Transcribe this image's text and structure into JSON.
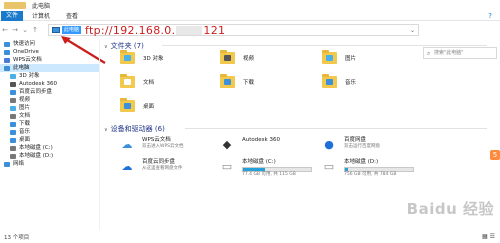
{
  "window": {
    "title": "此电脑"
  },
  "ribbon": {
    "file": "文件",
    "tabs": [
      "计算机",
      "查看"
    ],
    "help": "?"
  },
  "address": {
    "selected_label": "此电脑",
    "typed_prefix": "ftp://192.168.0.",
    "typed_suffix": "121"
  },
  "search": {
    "placeholder": "搜索\"此电脑\""
  },
  "nav": {
    "items": [
      {
        "label": "快速访问",
        "color": "#3c8fd9"
      },
      {
        "label": "OneDrive",
        "color": "#3c8fd9"
      },
      {
        "label": "WPS云文档",
        "color": "#4a7bd6"
      },
      {
        "label": "此电脑",
        "color": "#3c8fd9",
        "selected": true
      },
      {
        "label": "3D 对象",
        "color": "#4ab0e8",
        "indent": true
      },
      {
        "label": "Autodesk 360",
        "color": "#555555",
        "indent": true
      },
      {
        "label": "百度云同步盘",
        "color": "#3c8fd9",
        "indent": true
      },
      {
        "label": "视频",
        "color": "#777777",
        "indent": true
      },
      {
        "label": "图片",
        "color": "#4ab0e8",
        "indent": true
      },
      {
        "label": "文档",
        "color": "#777777",
        "indent": true
      },
      {
        "label": "下载",
        "color": "#3c8fd9",
        "indent": true
      },
      {
        "label": "音乐",
        "color": "#3c8fd9",
        "indent": true
      },
      {
        "label": "桌面",
        "color": "#3c8fd9",
        "indent": true
      },
      {
        "label": "本地磁盘 (C:)",
        "color": "#777777",
        "indent": true
      },
      {
        "label": "本地磁盘 (D:)",
        "color": "#777777",
        "indent": true
      },
      {
        "label": "网络",
        "color": "#3c8fd9"
      }
    ]
  },
  "folders": {
    "heading": "文件夹 (7)",
    "items": [
      {
        "label": "3D 对象",
        "color": "#4ab0e8"
      },
      {
        "label": "视频",
        "color": "#555555"
      },
      {
        "label": "图片",
        "color": "#4ab0e8"
      },
      {
        "label": "文档",
        "color": "#ffffff"
      },
      {
        "label": "下载",
        "color": "#3c8fd9"
      },
      {
        "label": "音乐",
        "color": "#3c8fd9"
      },
      {
        "label": "桌面",
        "color": "#3c8fd9"
      }
    ]
  },
  "devices": {
    "heading": "设备和驱动器 (6)",
    "items": [
      {
        "name": "WPS云文档",
        "sub": "双击进入WPS云文档",
        "icon": "cloud-icon",
        "glyph": "☁",
        "color": "#3c8fd9"
      },
      {
        "name": "Autodesk 360",
        "icon": "autodesk-icon",
        "glyph": "◆",
        "color": "#333333"
      },
      {
        "name": "百度网盘",
        "sub": "双击运行百度网盘",
        "icon": "baidu-pan-icon",
        "glyph": "●",
        "color": "#1f6fd9"
      },
      {
        "name": "百度云同步盘",
        "sub": "从这里查看网盘文件",
        "icon": "baidu-sync-icon",
        "glyph": "☁",
        "color": "#1f6fd9"
      },
      {
        "name": "本地磁盘 (C:)",
        "sub": "77.4 GB 可用, 共 115 GB",
        "icon": "drive-c-icon",
        "glyph": "▭",
        "color": "#888888",
        "fill": 0.33
      },
      {
        "name": "本地磁盘 (D:)",
        "sub": "756 GB 可用, 共 784 GB",
        "icon": "drive-d-icon",
        "glyph": "▭",
        "color": "#888888",
        "fill": 0.04
      }
    ]
  },
  "status": {
    "count": "13 个项目"
  },
  "badge": {
    "label": "5"
  },
  "watermark": {
    "text": "Baidu 经验"
  }
}
